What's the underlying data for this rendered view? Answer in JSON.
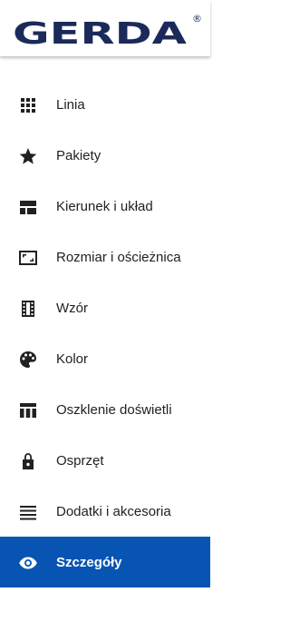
{
  "brand": {
    "name": "GERDA",
    "registered_mark": "®",
    "color": "#1c2a5a"
  },
  "nav": {
    "active_color": "#0754b3",
    "items": [
      {
        "label": "Linia",
        "icon": "grid-icon",
        "active": false
      },
      {
        "label": "Pakiety",
        "icon": "star-icon",
        "active": false
      },
      {
        "label": "Kierunek i układ",
        "icon": "layout-icon",
        "active": false
      },
      {
        "label": "Rozmiar i ościeżnica",
        "icon": "aspect-ratio-icon",
        "active": false
      },
      {
        "label": "Wzór",
        "icon": "film-strip-icon",
        "active": false
      },
      {
        "label": "Kolor",
        "icon": "palette-icon",
        "active": false
      },
      {
        "label": "Oszklenie doświetli",
        "icon": "table-columns-icon",
        "active": false
      },
      {
        "label": "Osprzęt",
        "icon": "lock-icon",
        "active": false
      },
      {
        "label": "Dodatki i akcesoria",
        "icon": "lines-icon",
        "active": false
      },
      {
        "label": "Szczegóły",
        "icon": "eye-icon",
        "active": true
      }
    ]
  }
}
